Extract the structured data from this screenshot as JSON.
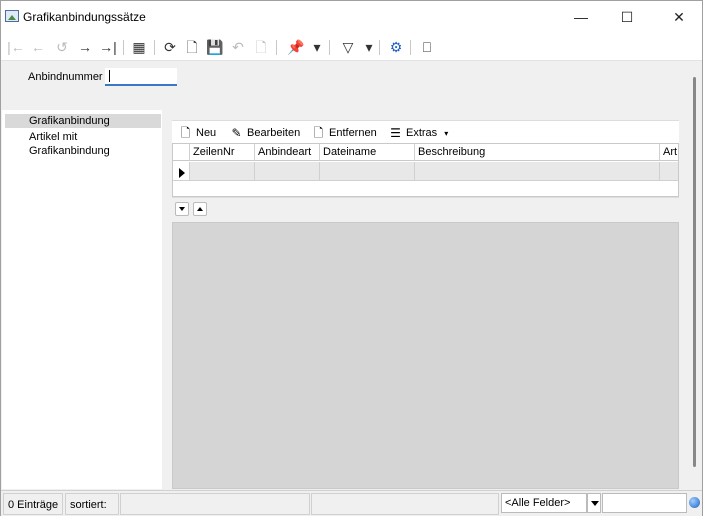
{
  "window": {
    "title": "Grafikanbindungssätze",
    "minimize_glyph": "—",
    "maximize_glyph": "☐",
    "close_glyph": "✕"
  },
  "toolbar": {
    "buttons": [
      {
        "icon": "first-record-icon",
        "glyph": "|←",
        "enabled": false
      },
      {
        "icon": "previous-record-icon",
        "glyph": "←",
        "enabled": false
      },
      {
        "icon": "history-icon",
        "glyph": "↺",
        "enabled": false
      },
      {
        "icon": "next-record-icon",
        "glyph": "→",
        "enabled": true
      },
      {
        "icon": "last-record-icon",
        "glyph": "→|",
        "enabled": true
      },
      {
        "icon": "table-view-icon",
        "glyph": "▦",
        "enabled": true
      },
      {
        "icon": "refresh-icon",
        "glyph": "⟳",
        "enabled": true
      },
      {
        "icon": "new-document-icon",
        "glyph": "🗋",
        "enabled": true
      },
      {
        "icon": "save-icon",
        "glyph": "💾",
        "enabled": false
      },
      {
        "icon": "undo-icon",
        "glyph": "↶",
        "enabled": false
      },
      {
        "icon": "delete-document-icon",
        "glyph": "🗋",
        "enabled": false
      },
      {
        "icon": "pin-icon",
        "glyph": "📌",
        "enabled": true
      },
      {
        "icon": "dropdown-icon",
        "glyph": "▾",
        "enabled": true
      },
      {
        "icon": "filter-icon",
        "glyph": "▽",
        "enabled": true
      },
      {
        "icon": "dropdown-icon",
        "glyph": "▾",
        "enabled": true
      },
      {
        "icon": "settings-icon",
        "glyph": "⚙",
        "enabled": true
      },
      {
        "icon": "exit-door-icon",
        "glyph": "⎕",
        "enabled": true
      }
    ]
  },
  "header": {
    "anbindnummer_label": "Anbindnummer",
    "anbindnummer_value": ""
  },
  "nav": {
    "items": [
      {
        "label": "Grafikanbindung",
        "selected": true
      },
      {
        "label": "Artikel mit Grafikanbindung",
        "selected": false
      }
    ]
  },
  "grid_toolbar": {
    "new_label": "Neu",
    "edit_label": "Bearbeiten",
    "remove_label": "Entfernen",
    "extras_label": "Extras"
  },
  "grid": {
    "columns": [
      "ZeilenNr",
      "Anbindeart",
      "Dateiname",
      "Beschreibung",
      "Art"
    ]
  },
  "status": {
    "entries": "0 Einträge",
    "sorted": "sortiert:",
    "filter_value": "<Alle Felder>"
  }
}
